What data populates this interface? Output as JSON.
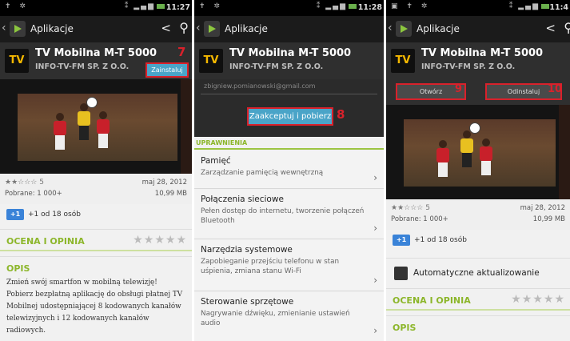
{
  "status": {
    "screen1_time": "11:27",
    "screen2_time": "11:28",
    "screen3_time": "11:4"
  },
  "actionbar": {
    "title": "Aplikacje",
    "back_glyph": "‹",
    "share_glyph": "<",
    "search_glyph": "⚲"
  },
  "app": {
    "name": "TV Mobilna M-T 5000",
    "publisher": "INFO-TV-FM SP. Z O.O.",
    "icon_text": "TV",
    "rating_stars": "★★☆☆☆ 5",
    "date": "maj 28, 2012",
    "downloads": "Pobrane: 1 000+",
    "size": "10,99 MB",
    "plus_badge": "+1",
    "plus_text": "+1 od 18 osób"
  },
  "screen1": {
    "install_label": "Zainstaluj",
    "step_marker": "7",
    "rating_section": "OCENA I OPINIA",
    "rating_stars_empty": "★★★★★",
    "description_section": "OPIS",
    "description": "Zmień swój smartfon w mobilną telewizję! Pobierz bezpłatną aplikację do obsługi płatnej TV Mobilnej udostępniającej 8 kodowanych kanałów telewizyjnych i 12 kodowanych kanałów radiowych."
  },
  "screen2": {
    "email": "zbigniew.pomianowski@gmail.com",
    "accept_label": "Zaakceptuj i pobierz",
    "step_marker": "8",
    "permissions_header": "UPRAWNIENIA",
    "permissions": [
      {
        "title": "Pamięć",
        "desc": "Zarządzanie pamięcią wewnętrzną"
      },
      {
        "title": "Połączenia sieciowe",
        "desc": "Pełen dostęp do internetu, tworzenie połączeń Bluetooth"
      },
      {
        "title": "Narzędzia systemowe",
        "desc": "Zapobieganie przejściu telefonu w stan uśpienia, zmiana stanu Wi-Fi"
      },
      {
        "title": "Sterowanie sprzętowe",
        "desc": "Nagrywanie dźwięku, zmienianie ustawień audio"
      }
    ],
    "chevron": "›"
  },
  "screen3": {
    "open_label": "Otwórz",
    "open_marker": "9",
    "uninstall_label": "Odinstaluj",
    "uninstall_marker": "10",
    "auto_update_label": "Automatyczne aktualizowanie",
    "rating_section": "OCENA I OPINIA",
    "rating_stars_empty": "★★★★★",
    "description_section": "OPIS"
  },
  "colors": {
    "accent_green": "#8cb62a",
    "install_blue": "#4aa4c8",
    "marker_red": "#d9212b"
  }
}
